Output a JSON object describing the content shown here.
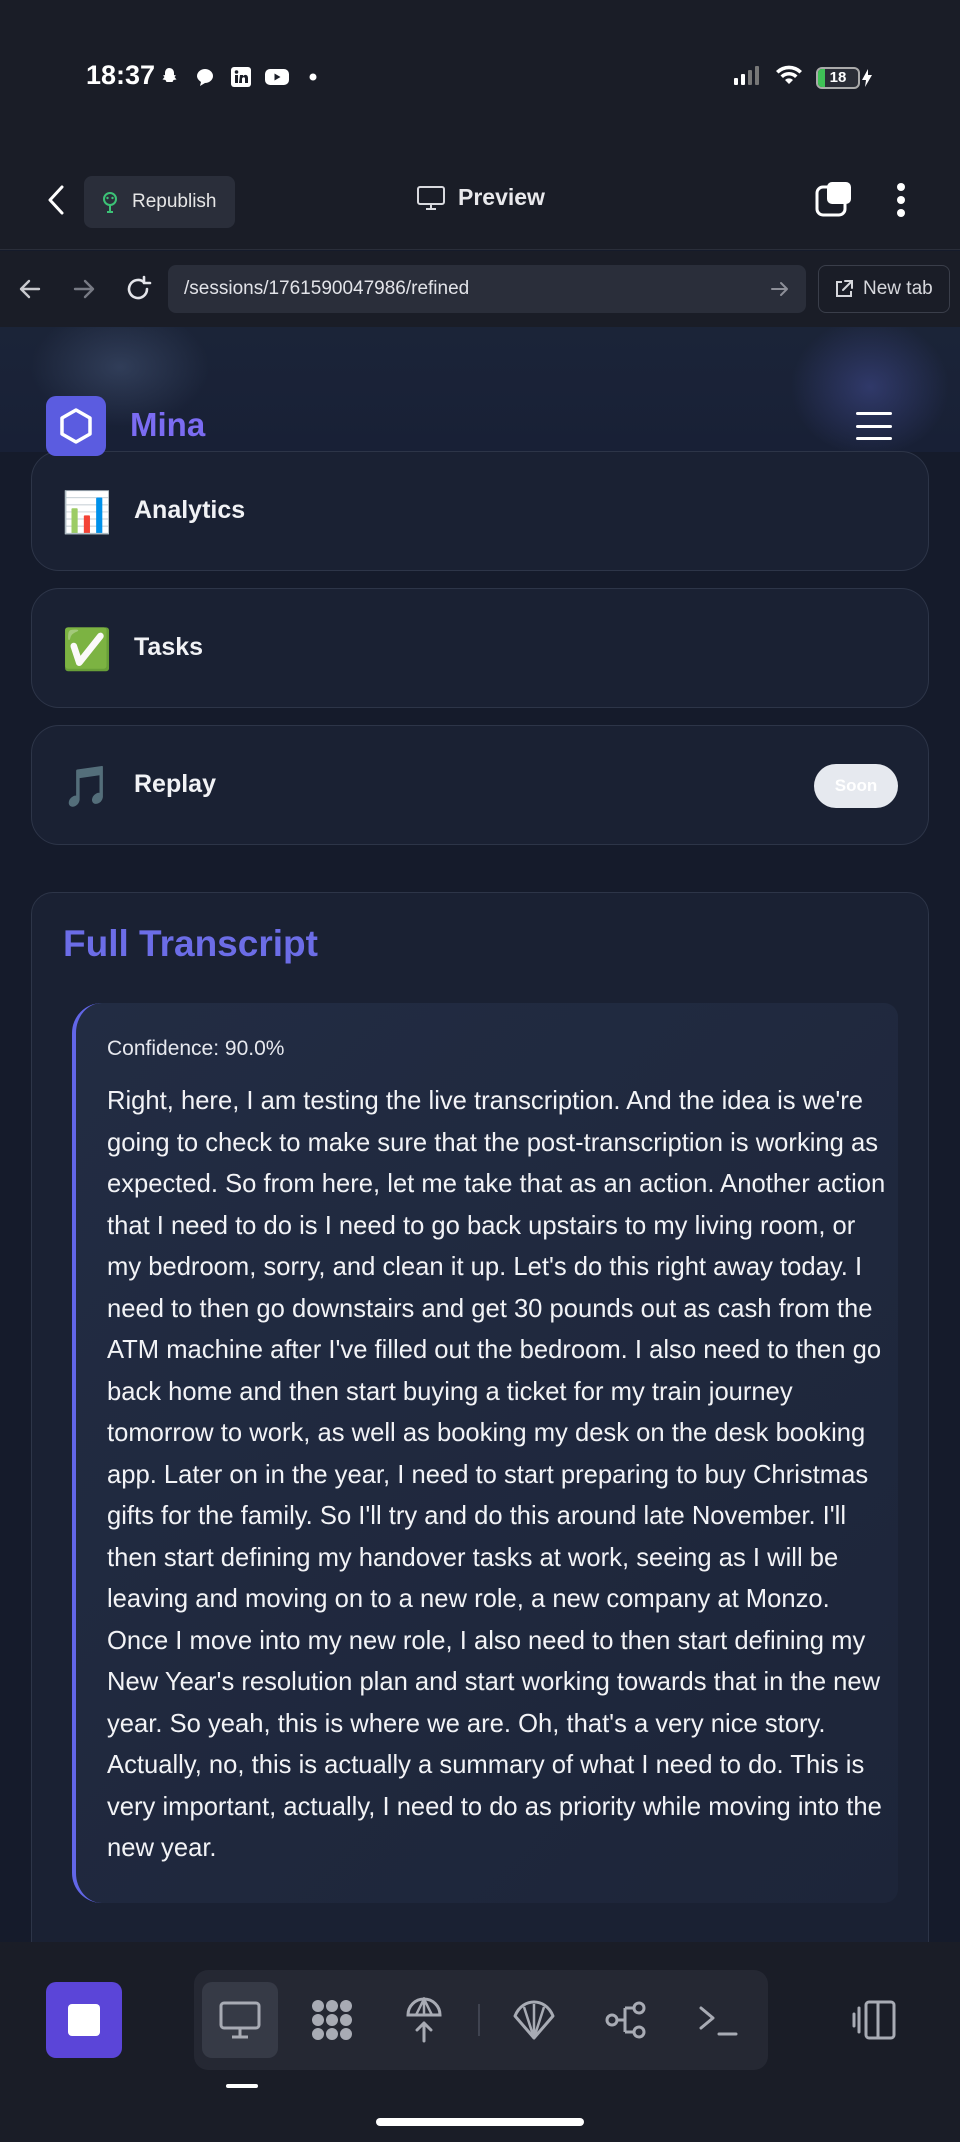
{
  "status_bar": {
    "time": "18:37",
    "notification_icons": [
      "snapchat-icon",
      "chat-bubble-icon",
      "linkedin-icon",
      "youtube-icon",
      "dot-icon"
    ],
    "battery_level": "18",
    "battery_fraction": 0.18
  },
  "app_bar": {
    "republish_label": "Republish",
    "preview_label": "Preview"
  },
  "url_bar": {
    "url": "/sessions/1761590047986/refined",
    "new_tab_label": "New tab"
  },
  "site": {
    "brand": "Mina",
    "menu_items": [
      {
        "label": "Analytics",
        "emoji": "📊",
        "badge": ""
      },
      {
        "label": "Tasks",
        "emoji": "✅",
        "badge": ""
      },
      {
        "label": "Replay",
        "emoji": "🎵",
        "badge": "Soon"
      }
    ]
  },
  "transcript": {
    "title": "Full Transcript",
    "confidence": "Confidence: 90.0%",
    "text": "Right, here, I am testing the live transcription. And the idea is we're going to check to make sure that the post-transcription is working as expected. So from here, let me take that as an action. Another action that I need to do is I need to go back upstairs to my living room, or my bedroom, sorry, and clean it up. Let's do this right away today. I need to then go downstairs and get 30 pounds out as cash from the ATM machine after I've filled out the bedroom. I also need to then go back home and then start buying a ticket for my train journey tomorrow to work, as well as booking my desk on the desk booking app. Later on in the year, I need to start preparing to buy Christmas gifts for the family. So I'll try and do this around late November. I'll then start defining my handover tasks at work, seeing as I will be leaving and moving on to a new role, a new company at Monzo. Once I move into my new role, I also need to then start defining my New Year's resolution plan and start working towards that in the new year. So yeah, this is where we are. Oh, that's a very nice story. Actually, no, this is actually a summary of what I need to do. This is very important, actually, I need to do as priority while moving into the new year.",
    "progress": 1.0
  },
  "bottom_toolbar": {
    "tools": [
      "monitor-icon",
      "apps-grid-icon",
      "deploy-icon",
      "shell-icon",
      "workflow-icon",
      "terminal-icon"
    ],
    "active_tool": "monitor-icon"
  },
  "colors": {
    "accent": "#6c6de7",
    "brand": "#7b6cf2",
    "stop_button": "#5b45d8",
    "progress": "#2a63e8"
  }
}
